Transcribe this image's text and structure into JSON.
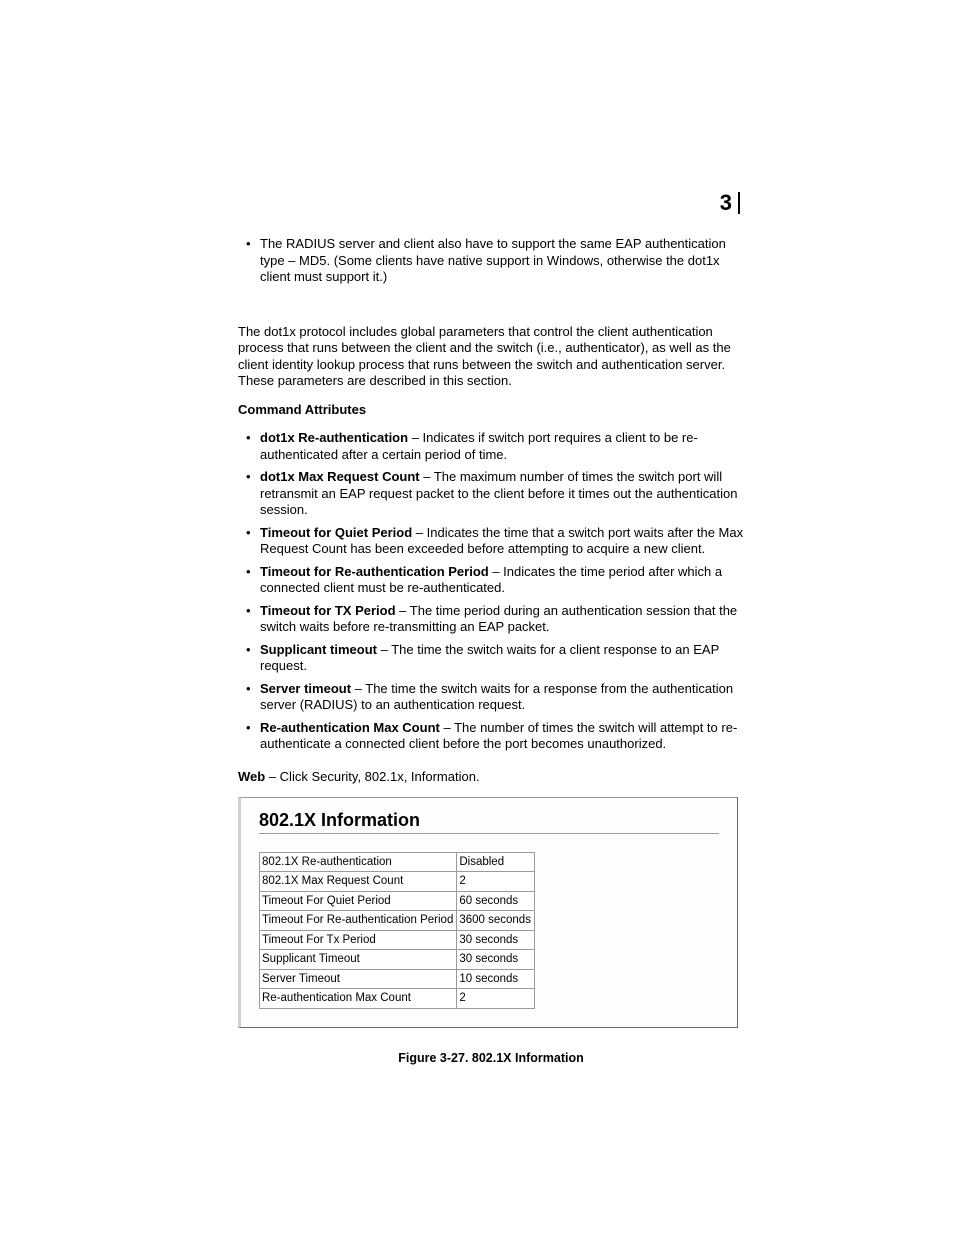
{
  "chapter_number": "3",
  "intro_bullet": "The RADIUS server and client also have to support the same EAP authentication type – MD5. (Some clients have native support in Windows, otherwise the dot1x client must support it.)",
  "paragraph1": "The dot1x protocol includes global parameters that control the client authentication process that runs between the client and the switch (i.e., authenticator), as well as the client identity lookup process that runs between the switch and authentication server. These parameters are described in this section.",
  "cmd_attr_heading": "Command Attributes",
  "attrs": [
    {
      "term": "dot1x Re-authentication",
      "desc": " – Indicates if switch port requires a client to be re-authenticated after a certain period of time."
    },
    {
      "term": "dot1x Max Request Count",
      "desc": " – The maximum number of times the switch port will retransmit an EAP request packet to the client before it times out the authentication session."
    },
    {
      "term": "Timeout for Quiet Period",
      "desc": " – Indicates the time that a switch port waits after the Max Request Count has been exceeded before attempting to acquire a new client."
    },
    {
      "term": "Timeout for Re-authentication Period",
      "desc": " – Indicates the time period after which a connected client must be re-authenticated."
    },
    {
      "term": "Timeout for TX Period",
      "desc": " – The time period during an authentication session that the switch waits before re-transmitting an EAP packet."
    },
    {
      "term": "Supplicant timeout",
      "desc": " – The time the switch waits for a client response to an EAP request."
    },
    {
      "term": "Server timeout",
      "desc": " – The time the switch waits for a response from the authentication server (RADIUS) to an authentication request."
    },
    {
      "term": "Re-authentication Max Count",
      "desc": " – The number of times the switch will attempt to re-authenticate a connected client before the port becomes unauthorized."
    }
  ],
  "web_label": "Web",
  "web_desc": " – Click Security, 802.1x, Information.",
  "screenshot": {
    "title": "802.1X Information",
    "rows": [
      {
        "label": "802.1X Re-authentication",
        "value": "Disabled"
      },
      {
        "label": "802.1X Max Request Count",
        "value": "2"
      },
      {
        "label": "Timeout For Quiet Period",
        "value": "60 seconds"
      },
      {
        "label": "Timeout For Re-authentication Period",
        "value": "3600 seconds"
      },
      {
        "label": "Timeout For Tx Period",
        "value": "30 seconds"
      },
      {
        "label": "Supplicant Timeout",
        "value": "30 seconds"
      },
      {
        "label": "Server Timeout",
        "value": "10 seconds"
      },
      {
        "label": "Re-authentication Max Count",
        "value": "2"
      }
    ]
  },
  "figure_caption": "Figure 3-27.  802.1X Information"
}
